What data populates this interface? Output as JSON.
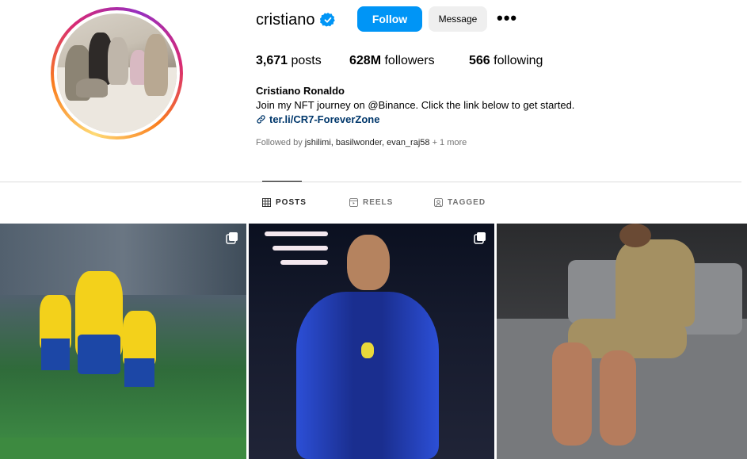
{
  "profile": {
    "username": "cristiano",
    "verified": true,
    "follow_label": "Follow",
    "message_label": "Message",
    "more_icon": "more-options-icon",
    "posts_count": "3,671",
    "posts_label": "posts",
    "followers_count": "628M",
    "followers_label": "followers",
    "following_count": "566",
    "following_label": "following",
    "full_name": "Cristiano Ronaldo",
    "bio": "Join my NFT journey on @Binance. Click the link below to get started.",
    "link": "ter.li/CR7-ForeverZone",
    "followed_by_prefix": "Followed by",
    "followed_by_names": "jshilimi, basilwonder, evan_raj58",
    "followed_by_more": "+ 1 more"
  },
  "tabs": [
    {
      "label": "POSTS",
      "icon": "grid-icon",
      "active": true
    },
    {
      "label": "REELS",
      "icon": "reels-icon",
      "active": false
    },
    {
      "label": "TAGGED",
      "icon": "tagged-icon",
      "active": false
    }
  ],
  "colors": {
    "follow_button": "#0095f6",
    "message_button": "#efefef",
    "link": "#00376b",
    "verified": "#0095f6",
    "muted_text": "#737373"
  }
}
